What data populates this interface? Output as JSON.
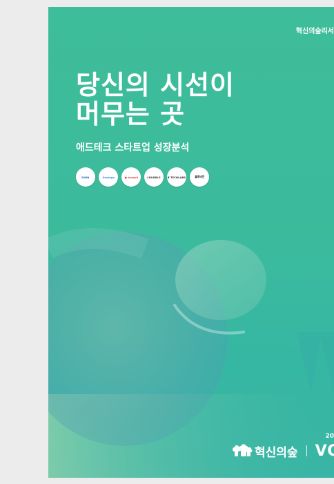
{
  "cover": {
    "series_label": "혁신의숲리서",
    "headline_line1": "당신의 시선이",
    "headline_line2": "머무는 곳",
    "subtitle": "애드테크 스타트업 성장분석",
    "year_fragment": "20",
    "brand_name": "혁신의숲",
    "partner_fragment": "VO",
    "colors": {
      "background": "#3ebd9a",
      "text": "#ffffff"
    }
  },
  "logos": [
    {
      "label": "DION",
      "color": "#1e5fb4"
    },
    {
      "label": "Geologo",
      "color": "#3a8fd6"
    },
    {
      "label": "● buzzvil",
      "color": "#e0403a"
    },
    {
      "label": "◎BUBBLE",
      "color": "#444444"
    },
    {
      "label": "▼ TECHLABS",
      "color": "#333333"
    },
    {
      "label": "블루비컨",
      "color": "#222222"
    }
  ]
}
